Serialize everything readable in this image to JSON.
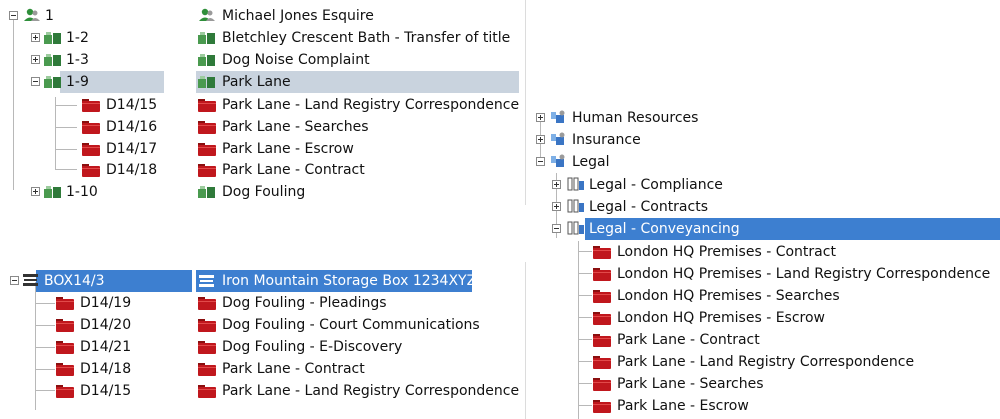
{
  "top_left": {
    "rows": [
      {
        "code": "1",
        "title": "Michael Jones Esquire"
      },
      {
        "code": "1-2",
        "title": "Bletchley Crescent Bath - Transfer of title"
      },
      {
        "code": "1-3",
        "title": "Dog Noise Complaint"
      },
      {
        "code": "1-9",
        "title": "Park Lane"
      },
      {
        "code": "D14/15",
        "title": "Park Lane - Land Registry Correspondence"
      },
      {
        "code": "D14/16",
        "title": "Park Lane - Searches"
      },
      {
        "code": "D14/17",
        "title": "Park Lane - Escrow"
      },
      {
        "code": "D14/18",
        "title": "Park Lane - Contract"
      },
      {
        "code": "1-10",
        "title": "Dog Fouling"
      }
    ]
  },
  "bottom_left": {
    "rows": [
      {
        "code": "BOX14/3",
        "title": "Iron Mountain Storage Box 1234XYZ"
      },
      {
        "code": "D14/19",
        "title": "Dog Fouling - Pleadings"
      },
      {
        "code": "D14/20",
        "title": "Dog Fouling - Court Communications"
      },
      {
        "code": "D14/21",
        "title": "Dog Fouling - E-Discovery"
      },
      {
        "code": "D14/18",
        "title": "Park Lane - Contract"
      },
      {
        "code": "D14/15",
        "title": "Park Lane - Land Registry Correspondence"
      }
    ]
  },
  "right": {
    "rows": [
      {
        "label": "Human Resources"
      },
      {
        "label": "Insurance"
      },
      {
        "label": "Legal"
      },
      {
        "label": "Legal - Compliance"
      },
      {
        "label": "Legal - Contracts"
      },
      {
        "label": "Legal - Conveyancing"
      },
      {
        "label": "London HQ Premises - Contract"
      },
      {
        "label": "London HQ Premises - Land Registry Correspondence"
      },
      {
        "label": "London HQ Premises - Searches"
      },
      {
        "label": "London HQ Premises - Escrow"
      },
      {
        "label": "Park Lane - Contract"
      },
      {
        "label": "Park Lane - Land Registry Correspondence"
      },
      {
        "label": "Park Lane - Searches"
      },
      {
        "label": "Park Lane - Escrow"
      }
    ]
  },
  "icons": {
    "client": "person-icon",
    "matter": "matter-icon",
    "folder": "red-folder-icon",
    "box": "storage-box-icon",
    "group": "group-icon",
    "binder": "binder-icon"
  },
  "colors": {
    "selection_grey": "#c9d3de",
    "selection_blue": "#3d7fd0",
    "folder_red": "#c0171d",
    "matter_green": "#2f8f3a",
    "group_blue": "#3a75c4"
  }
}
